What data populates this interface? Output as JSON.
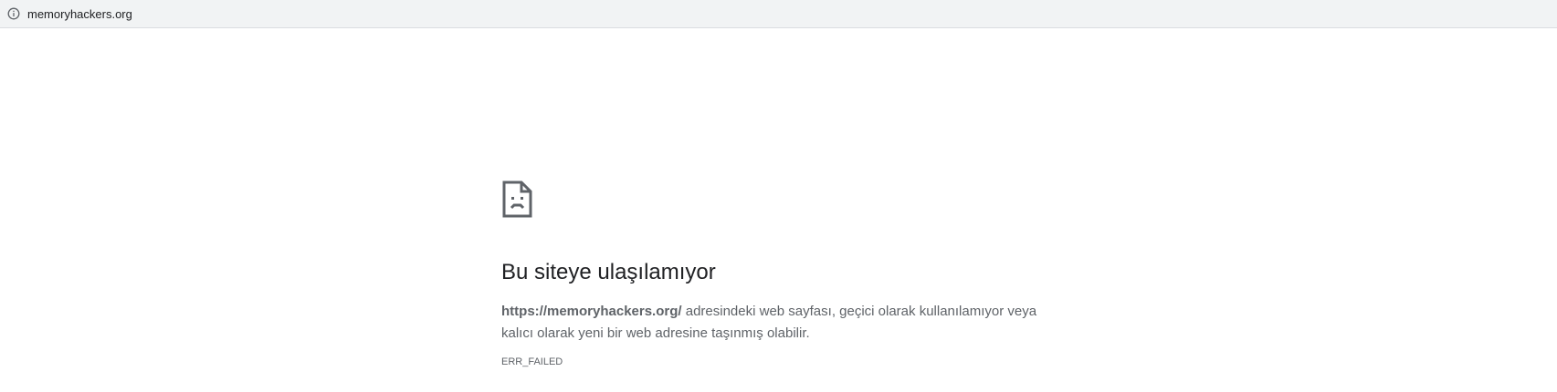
{
  "address_bar": {
    "icon": "info-icon",
    "url": "memoryhackers.org"
  },
  "error": {
    "icon": "sad-page-icon",
    "title": "Bu siteye ulaşılamıyor",
    "url_bold": "https://memoryhackers.org/",
    "message_line_1": " adresindeki web sayfası, geçici olarak kullanılamıyor veya",
    "message_line_2": "kalıcı olarak yeni bir web adresine taşınmış olabilir.",
    "code": "ERR_FAILED"
  },
  "colors": {
    "address_bar_background": "#f1f3f4",
    "title_text": "#202124",
    "secondary_text": "#5f6368"
  }
}
